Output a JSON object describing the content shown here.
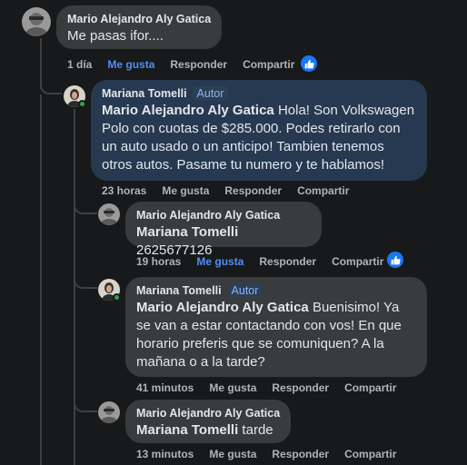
{
  "colors": {
    "background": "#18191a",
    "bubble": "#3a3b3c",
    "highlight_bubble": "#263951",
    "author_badge": "#8ab4f8",
    "liked_action": "#4e8ef7",
    "meta_text": "#b0b3b8",
    "online": "#31a24c",
    "like_reaction": "#1877f2"
  },
  "comments": [
    {
      "author": "Mario Alejandro Aly Gatica",
      "text": "Me pasas ifor....",
      "time": "1 día",
      "like": "Me gusta",
      "reply": "Responder",
      "share": "Compartir",
      "liked": true,
      "reaction_icon": "thumbs-up-icon"
    },
    {
      "author": "Mariana Tomelli",
      "badge": "Autor",
      "mention": "Mario Alejandro Aly Gatica",
      "text": " Hola! Son Volkswagen Polo con cuotas de $285.000. Podes retirarlo con un auto usado o un anticipo! Tambien tenemos otros autos. Pasame tu numero y te hablamos!",
      "time": "23 horas",
      "like": "Me gusta",
      "reply": "Responder",
      "share": "Compartir",
      "online": true
    },
    {
      "author": "Mario Alejandro Aly Gatica",
      "mention": "Mariana Tomelli",
      "text": " 2625677126",
      "time": "19 horas",
      "like": "Me gusta",
      "reply": "Responder",
      "share": "Compartir",
      "liked": true,
      "reaction_icon": "thumbs-up-icon"
    },
    {
      "author": "Mariana Tomelli",
      "badge": "Autor",
      "mention": "Mario Alejandro Aly Gatica",
      "text": " Buenisimo! Ya se van a estar contactando con vos! En que horario preferis que se comuniquen? A la mañana o a la tarde?",
      "time": "41 minutos",
      "like": "Me gusta",
      "reply": "Responder",
      "share": "Compartir",
      "online": true
    },
    {
      "author": "Mario Alejandro Aly Gatica",
      "mention": "Mariana Tomelli",
      "text": " tarde",
      "time": "13 minutos",
      "like": "Me gusta",
      "reply": "Responder",
      "share": "Compartir"
    }
  ]
}
